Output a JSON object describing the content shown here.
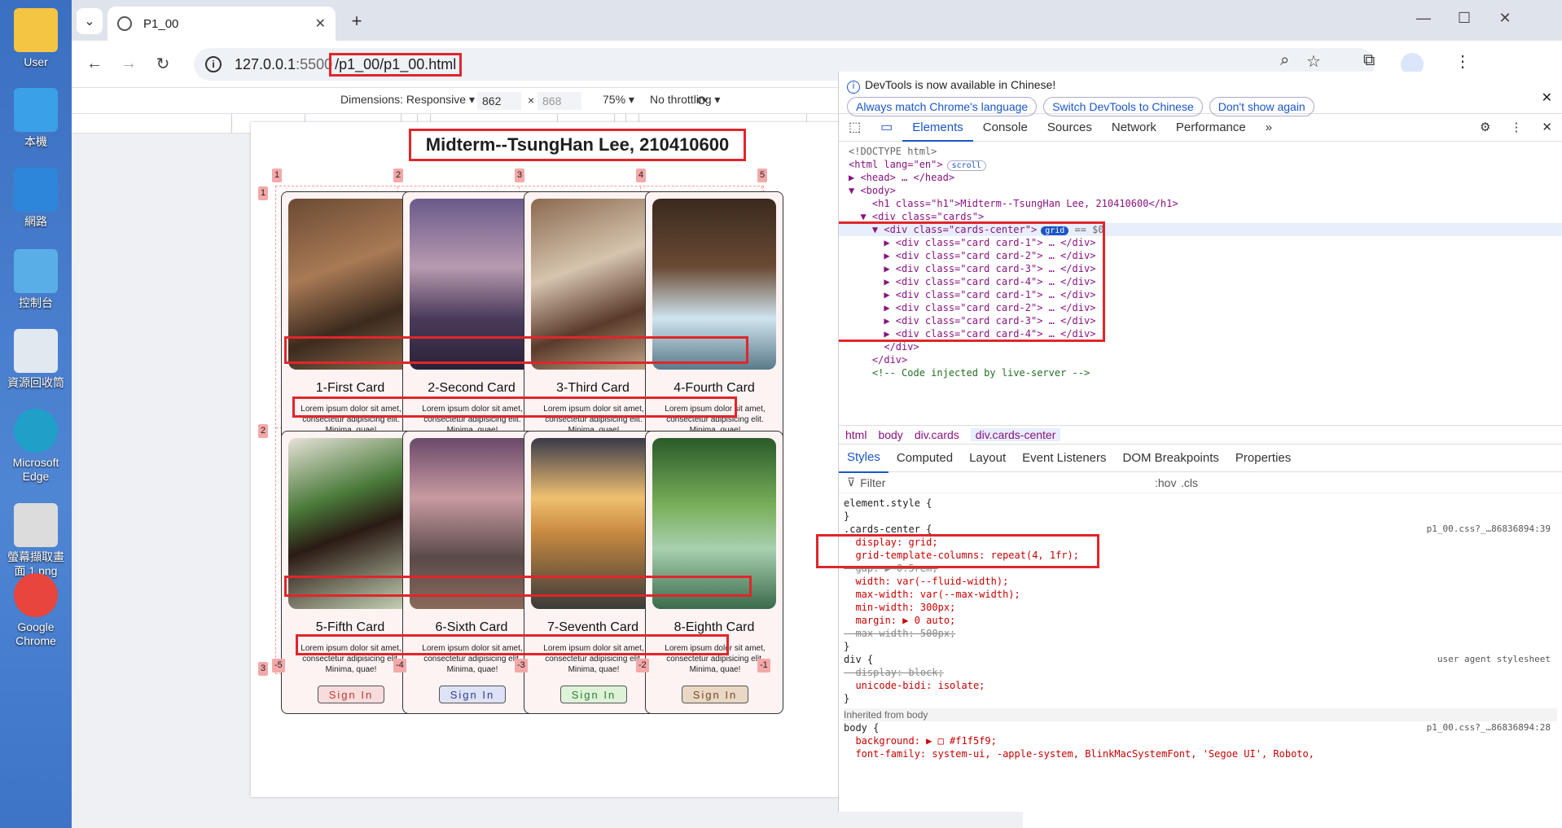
{
  "desktop": {
    "icons": [
      {
        "label": "User",
        "color": "#f4c542"
      },
      {
        "label": "本機",
        "color": "#3aa0e8"
      },
      {
        "label": "網路",
        "color": "#2d86d9"
      },
      {
        "label": "控制台",
        "color": "#5aaee8"
      },
      {
        "label": "資源回收筒",
        "color": "#e0e8f0"
      },
      {
        "label": "Microsoft Edge",
        "color": "#1fa0c8"
      },
      {
        "label": "螢幕擷取畫面 1.png",
        "color": "#dcdcdc"
      },
      {
        "label": "Google Chrome",
        "color": "#e8453c"
      }
    ]
  },
  "browser": {
    "tab_title": "P1_00",
    "new_tab": "+",
    "url_host": "127.0.0.1",
    "url_port": ":5500",
    "url_path": "/p1_00/p1_00.html"
  },
  "devbar": {
    "dimensions": "Dimensions: Responsive ▾",
    "width": "862",
    "x": "×",
    "height": "868",
    "zoom": "75% ▾",
    "throttle": "No throttling ▾"
  },
  "page": {
    "h1": "Midterm--TsungHan Lee, 210410600",
    "cards": [
      {
        "title": "1-First Card",
        "btn": "Sign In",
        "btn_color": "#c0392b",
        "btn_bg": "#f6dcdc"
      },
      {
        "title": "2-Second Card",
        "btn": "Sign In",
        "btn_color": "#2c3e8f",
        "btn_bg": "#dde2f4"
      },
      {
        "title": "3-Third Card",
        "btn": "Sign In",
        "btn_color": "#2e7d32",
        "btn_bg": "#def2d8"
      },
      {
        "title": "4-Fourth Card",
        "btn": "Sign In",
        "btn_color": "#6d4c2a",
        "btn_bg": "#ead8c4"
      },
      {
        "title": "5-Fifth Card",
        "btn": "Sign In",
        "btn_color": "#c0392b",
        "btn_bg": "#f6dcdc"
      },
      {
        "title": "6-Sixth Card",
        "btn": "Sign In",
        "btn_color": "#2c3e8f",
        "btn_bg": "#dde2f4"
      },
      {
        "title": "7-Seventh Card",
        "btn": "Sign In",
        "btn_color": "#2e7d32",
        "btn_bg": "#def2d8"
      },
      {
        "title": "8-Eighth Card",
        "btn": "Sign In",
        "btn_color": "#6d4c2a",
        "btn_bg": "#ead8c4"
      }
    ],
    "lorem": "Lorem ipsum dolor sit amet, consectetur adipisicing elit. Minima, quae!",
    "grid_cols": [
      "1",
      "2",
      "3",
      "4",
      "5"
    ],
    "grid_rows": [
      "1",
      "2",
      "3"
    ],
    "grid_neg_cols": [
      "-5",
      "-4",
      "-3",
      "-2",
      "-1"
    ],
    "grid_neg_top": "-1"
  },
  "devtools": {
    "banner": "DevTools is now available in Chinese!",
    "btn1": "Always match Chrome's language",
    "btn2": "Switch DevTools to Chinese",
    "btn3": "Don't show again",
    "tabs": [
      "Elements",
      "Console",
      "Sources",
      "Network",
      "Performance"
    ],
    "tree": [
      {
        "t": "<!DOCTYPE html>",
        "c": "gy"
      },
      {
        "t": "<html lang=\"en\">",
        "c": "tag",
        "pill": "scroll"
      },
      {
        "t": "▶ <head> … </head>",
        "c": "tag"
      },
      {
        "t": "▼ <body>",
        "c": "tag"
      },
      {
        "t": "    <h1 class=\"h1\">Midterm--TsungHan Lee, 210410600</h1>",
        "c": "tag"
      },
      {
        "t": "  ▼ <div class=\"cards\">",
        "c": "tag"
      },
      {
        "t": "    ▼ <div class=\"cards-center\">",
        "c": "tag",
        "pill": "grid",
        "tail": " == $0"
      },
      {
        "t": "      ▶ <div class=\"card card-1\"> … </div>",
        "c": "tag"
      },
      {
        "t": "      ▶ <div class=\"card card-2\"> … </div>",
        "c": "tag"
      },
      {
        "t": "      ▶ <div class=\"card card-3\"> … </div>",
        "c": "tag"
      },
      {
        "t": "      ▶ <div class=\"card card-4\"> … </div>",
        "c": "tag"
      },
      {
        "t": "      ▶ <div class=\"card card-1\"> … </div>",
        "c": "tag"
      },
      {
        "t": "      ▶ <div class=\"card card-2\"> … </div>",
        "c": "tag"
      },
      {
        "t": "      ▶ <div class=\"card card-3\"> … </div>",
        "c": "tag"
      },
      {
        "t": "      ▶ <div class=\"card card-4\"> … </div>",
        "c": "tag"
      },
      {
        "t": "      </div>",
        "c": "tag"
      },
      {
        "t": "    </div>",
        "c": "tag"
      },
      {
        "t": "    <!-- Code injected by live-server -->",
        "c": "cm"
      }
    ],
    "crumbs": [
      "html",
      "body",
      "div.cards",
      "div.cards-center"
    ],
    "style_tabs": [
      "Styles",
      "Computed",
      "Layout",
      "Event Listeners",
      "DOM Breakpoints",
      "Properties"
    ],
    "filter": "Filter",
    "hov": ":hov",
    "cls": ".cls",
    "styles": [
      {
        "t": "element.style {",
        "c": "pv"
      },
      {
        "t": "}",
        "c": "pv"
      },
      {
        "t": ".cards-center {",
        "c": "pv",
        "src": "p1_00.css?_…86836894:39"
      },
      {
        "t": "  display: grid;",
        "c": "pn"
      },
      {
        "t": "  grid-template-columns: repeat(4, 1fr);",
        "c": "pn"
      },
      {
        "t": "  gap: ▶ 0.5rem;",
        "c": "st"
      },
      {
        "t": "  width: var(--fluid-width);",
        "c": "pn"
      },
      {
        "t": "  max-width: var(--max-width);",
        "c": "pn"
      },
      {
        "t": "  min-width: 300px;",
        "c": "pn"
      },
      {
        "t": "  margin: ▶ 0 auto;",
        "c": "pn"
      },
      {
        "t": "  max-width: 500px;",
        "c": "st"
      },
      {
        "t": "}",
        "c": "pv"
      },
      {
        "t": "div {",
        "c": "pv",
        "src": "user agent stylesheet"
      },
      {
        "t": "  display: block;",
        "c": "st"
      },
      {
        "t": "  unicode-bidi: isolate;",
        "c": "pn"
      },
      {
        "t": "}",
        "c": "pv"
      },
      {
        "t": "Inherited from body",
        "c": "gy"
      },
      {
        "t": "body {",
        "c": "pv",
        "src": "p1_00.css?_…86836894:28"
      },
      {
        "t": "  background: ▶ □ #f1f5f9;",
        "c": "pn"
      },
      {
        "t": "  font-family: system-ui, -apple-system, BlinkMacSystemFont, 'Segoe UI', Roboto,",
        "c": "pn"
      }
    ]
  }
}
